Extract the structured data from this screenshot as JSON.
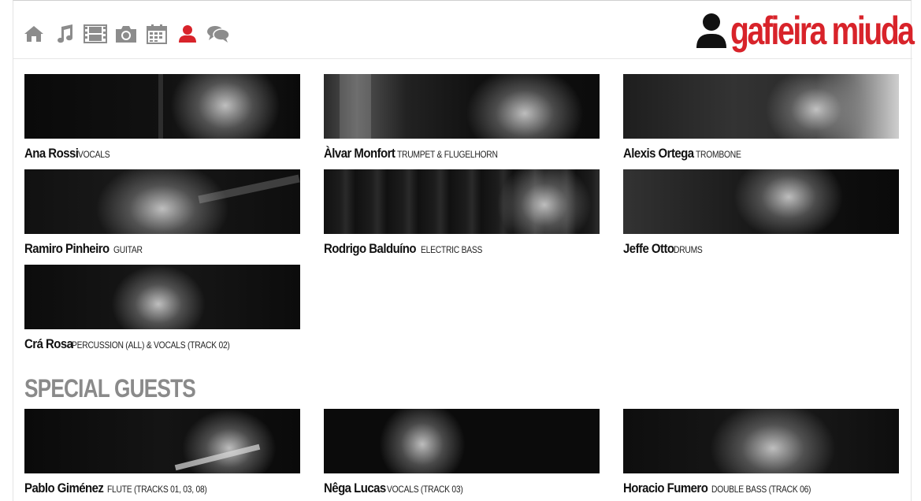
{
  "nav": [
    {
      "icon": "home-icon",
      "active": false
    },
    {
      "icon": "music-icon",
      "active": false
    },
    {
      "icon": "film-icon",
      "active": false
    },
    {
      "icon": "camera-icon",
      "active": false
    },
    {
      "icon": "calendar-icon",
      "active": false
    },
    {
      "icon": "user-icon",
      "active": true
    },
    {
      "icon": "comments-icon",
      "active": false
    }
  ],
  "colors": {
    "accent": "#d8232a",
    "icon_gray": "#8c8c8c",
    "heading_gray": "#8a8a8a"
  },
  "logo": {
    "text": "gafieira miuda"
  },
  "musicians": [
    {
      "name": "Ana Rossi",
      "role": "VOCALS"
    },
    {
      "name": "Àlvar Monfort",
      "role": "TRUMPET & FLUGELHORN"
    },
    {
      "name": "Alexis Ortega",
      "role": "TROMBONE"
    },
    {
      "name": "Ramiro Pinheiro",
      "role": "GUITAR"
    },
    {
      "name": "Rodrigo Balduíno",
      "role": "ELECTRIC BASS"
    },
    {
      "name": "Jeffe Otto",
      "role": "DRUMS"
    },
    {
      "name": "Crá Rosa",
      "role": "PERCUSSION (ALL) & VOCALS (TRACK 02)"
    }
  ],
  "special_guests": {
    "title": "SPECIAL GUESTS",
    "items": [
      {
        "name": "Pablo Giménez",
        "role": "FLUTE (TRACKS 01, 03, 08)"
      },
      {
        "name": "Nêga Lucas",
        "role": "VOCALS (TRACK 03)"
      },
      {
        "name": "Horacio Fumero",
        "role": "DOUBLE BASS (TRACK 06)"
      }
    ]
  }
}
